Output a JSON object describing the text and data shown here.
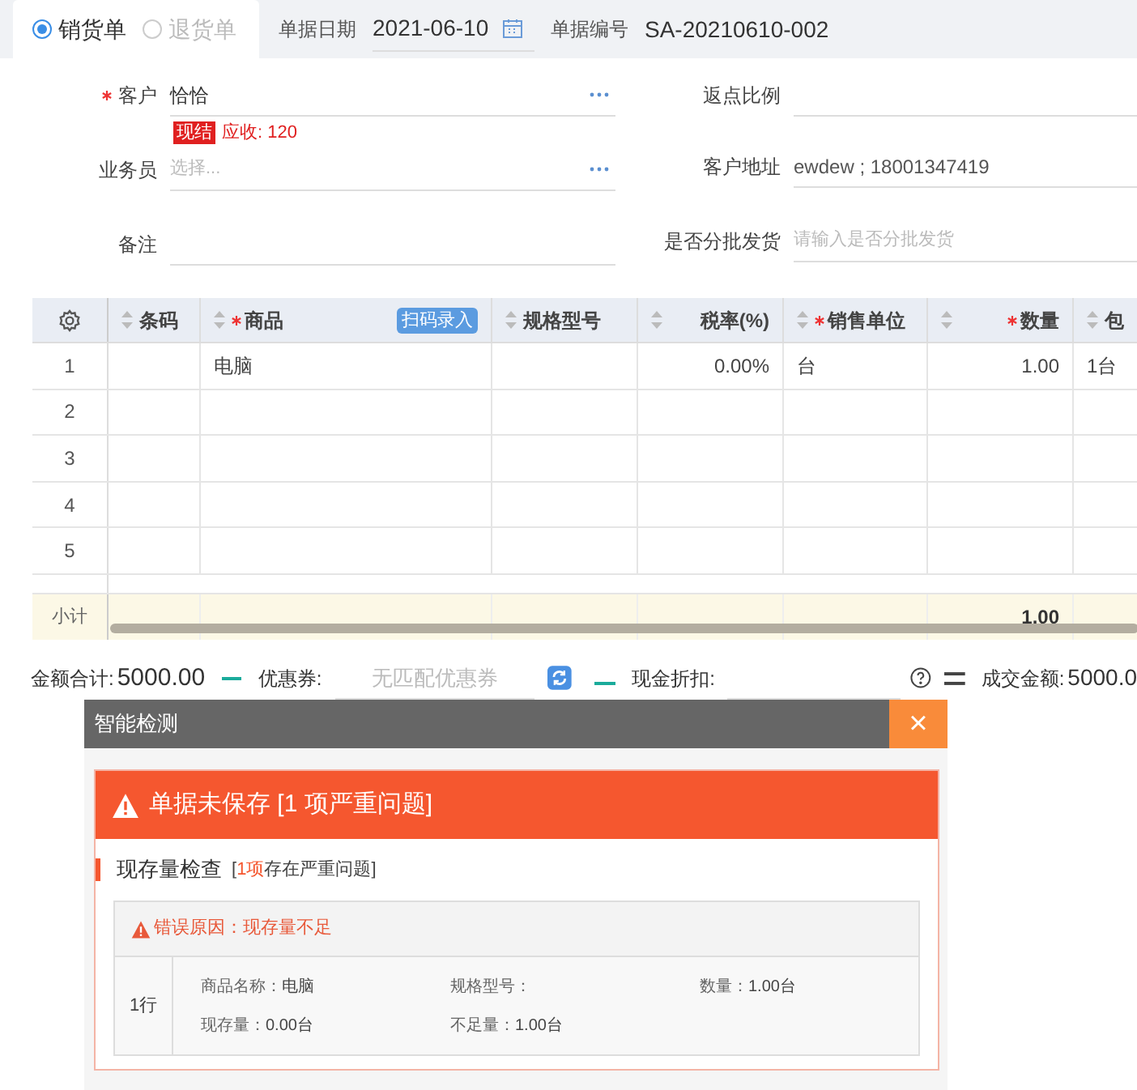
{
  "doc_types": [
    {
      "label": "销货单",
      "selected": true
    },
    {
      "label": "退货单",
      "selected": false
    }
  ],
  "header_fields": [
    {
      "label": "单据日期",
      "value": "2021-06-10",
      "kind": "date"
    },
    {
      "label": "单据编号",
      "value": "SA-20210610-002",
      "kind": "text"
    }
  ],
  "customer": {
    "label": "客户",
    "required": true,
    "value": "恰恰",
    "tag": "现结",
    "receivable": "应收: 120"
  },
  "salesman": {
    "label": "业务员",
    "placeholder": "选择..."
  },
  "remark": {
    "label": "备注"
  },
  "rebate": {
    "label": "返点比例"
  },
  "address": {
    "label": "客户地址",
    "value": "ewdew ; 18001347419"
  },
  "batch": {
    "label": "是否分批发货",
    "placeholder": "请输入是否分批发货"
  },
  "table": {
    "columns": [
      {
        "label": "条码",
        "required": false,
        "kind": "text"
      },
      {
        "label": "商品",
        "required": true,
        "kind": "text",
        "button": "扫码录入"
      },
      {
        "label": "规格型号",
        "required": false,
        "kind": "text"
      },
      {
        "label": "税率(%)",
        "required": false,
        "kind": "number"
      },
      {
        "label": "销售单位",
        "required": true,
        "kind": "text"
      },
      {
        "label": "数量",
        "required": true,
        "kind": "number"
      },
      {
        "label": "包",
        "required": false,
        "kind": "text"
      }
    ],
    "rows": [
      {
        "index": "1",
        "cells": [
          "",
          "电脑",
          "",
          "0.00%",
          "台",
          "1.00",
          "1台"
        ]
      },
      {
        "index": "2",
        "cells": [
          "",
          "",
          "",
          "",
          "",
          "",
          ""
        ]
      },
      {
        "index": "3",
        "cells": [
          "",
          "",
          "",
          "",
          "",
          "",
          ""
        ]
      },
      {
        "index": "4",
        "cells": [
          "",
          "",
          "",
          "",
          "",
          "",
          ""
        ]
      },
      {
        "index": "5",
        "cells": [
          "",
          "",
          "",
          "",
          "",
          "",
          ""
        ]
      }
    ],
    "subtotal": {
      "label": "小计",
      "cells": [
        "",
        "",
        "",
        "",
        "",
        "1.00",
        ""
      ]
    }
  },
  "totals": {
    "amount_label": "金额合计:",
    "amount": "5000.00",
    "coupon_label": "优惠券:",
    "coupon_placeholder": "无匹配优惠券",
    "cash_discount_label": "现金折扣:",
    "final_label": "成交金额:",
    "final": "5000.0"
  },
  "dialog": {
    "title": "智能检测",
    "close": "×",
    "banner": "单据未保存 [1 项严重问题]",
    "section": {
      "title": "现存量检查",
      "note_open": "[",
      "note_count": "1项",
      "note_rest": "存在严重问题]",
      "error": "错误原因：现存量不足",
      "row_label": "1行",
      "details": [
        {
          "label": "商品名称：",
          "value": "电脑"
        },
        {
          "label": "规格型号："
        },
        {
          "label": "数量：",
          "value": "1.00台"
        },
        {
          "label": "现存量：",
          "value": "0.00台"
        },
        {
          "label": "不足量：",
          "value": "1.00台"
        }
      ]
    }
  }
}
